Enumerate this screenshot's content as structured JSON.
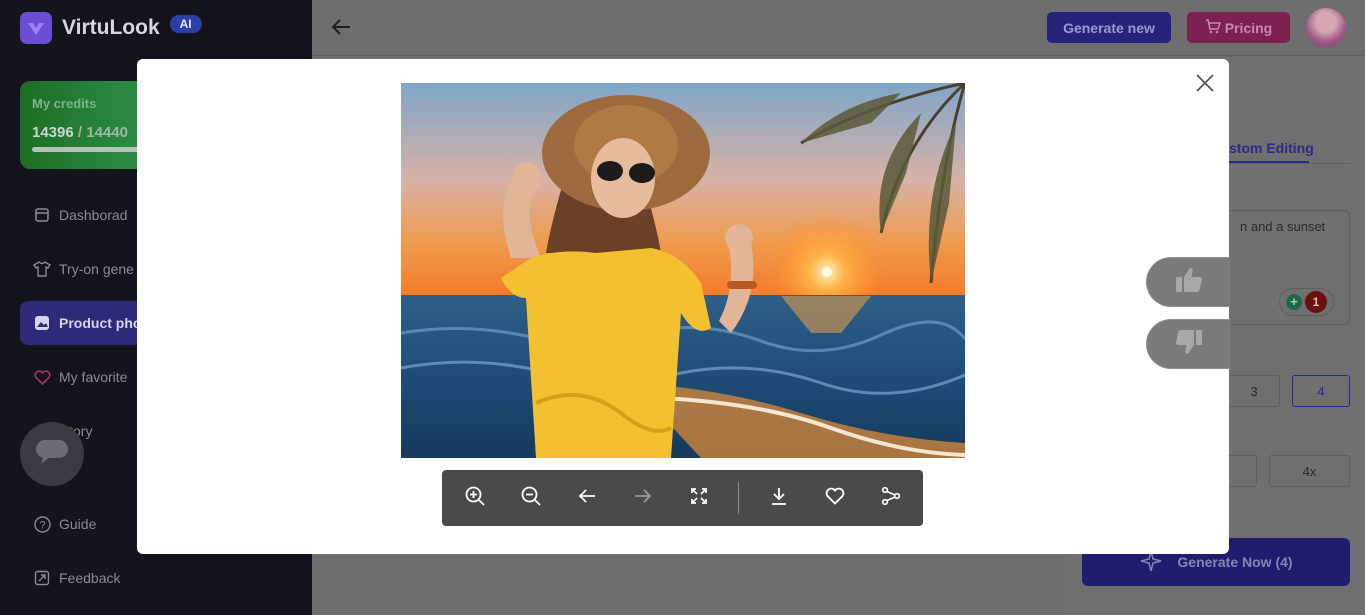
{
  "app": {
    "name": "VirtuLook",
    "badge": "AI"
  },
  "credits": {
    "title": "My credits",
    "current": "14396",
    "separator": " / ",
    "total": "14440",
    "fraction_used": 0.997
  },
  "sidebar": {
    "items": [
      {
        "label": "Dashborad",
        "icon": "dashboard-icon"
      },
      {
        "label": "Try-on gene",
        "icon": "tshirt-icon"
      },
      {
        "label": "Product pho",
        "icon": "image-icon",
        "active": true
      },
      {
        "label": "My favorite",
        "icon": "heart-icon"
      },
      {
        "label": "istory",
        "icon": "history-icon"
      },
      {
        "label": "Guide",
        "icon": "question-icon"
      },
      {
        "label": "Feedback",
        "icon": "feedback-icon"
      }
    ]
  },
  "header": {
    "generate_new": "Generate new",
    "pricing": "Pricing"
  },
  "panel": {
    "tab_label": "stom Editing",
    "prompt_text": "n and a sunset",
    "prompt_count": "1",
    "counts": [
      "3",
      "4"
    ],
    "scales": [
      "4x"
    ],
    "generate_now": "Generate Now (4)"
  },
  "viewer": {
    "tools": [
      {
        "name": "zoom-in-icon"
      },
      {
        "name": "zoom-out-icon"
      },
      {
        "name": "prev-arrow-icon"
      },
      {
        "name": "next-arrow-icon"
      },
      {
        "name": "fullscreen-icon"
      },
      {
        "name": "download-icon"
      },
      {
        "name": "favorite-heart-icon"
      },
      {
        "name": "share-icon"
      }
    ]
  },
  "colors": {
    "accent": "#2f2a7a",
    "pricing": "#7c2150",
    "credits_green": "#2a8a42",
    "toolbar": "#4a4a4a"
  }
}
